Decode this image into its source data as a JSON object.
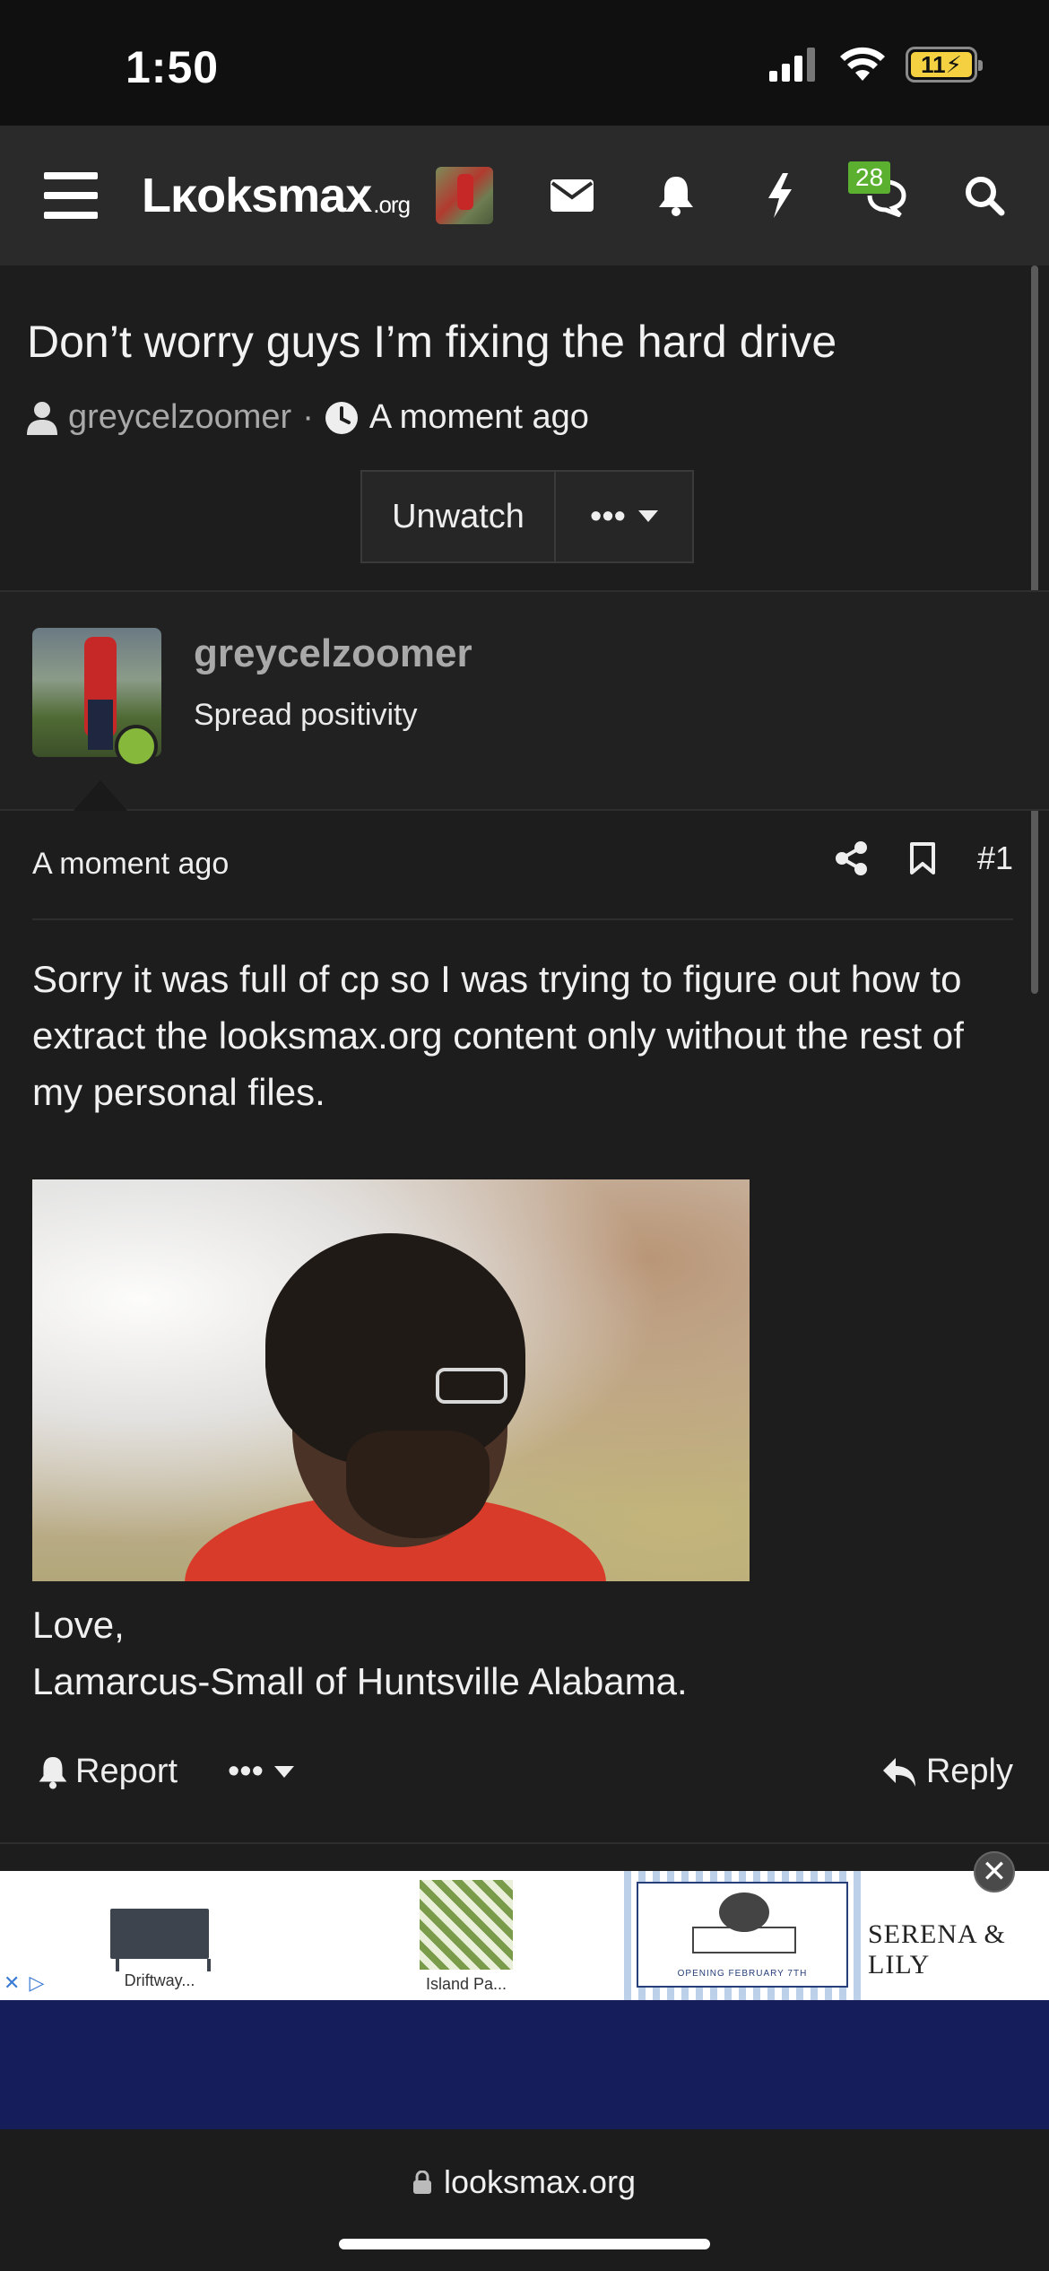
{
  "status_bar": {
    "time": "1:50",
    "battery": "11"
  },
  "nav": {
    "logo": "Lκoksmax",
    "logo_suffix": ".org",
    "chat_badge": "28"
  },
  "thread": {
    "title": "Don’t worry guys I’m fixing the hard drive",
    "author": "greycelzoomer",
    "separator": "·",
    "time": "A moment ago",
    "unwatch_label": "Unwatch",
    "more_label": "•••"
  },
  "post": {
    "username": "greycelzoomer",
    "user_title": "Spread positivity",
    "time": "A moment ago",
    "post_number": "#1",
    "body": "Sorry it was full of cp so I was trying to figure out how to extract the looksmax.org content only without the rest of my personal files.",
    "signature_line1": "Love,",
    "signature_line2": "Lamarcus-Small of Huntsville Alabama.",
    "report_label": "Report",
    "more_label": "•••",
    "reply_label": "Reply"
  },
  "ad": {
    "item1": "Driftway...",
    "item2": "Island Pa...",
    "item3_caption": "OPENING FEBRUARY 7TH",
    "brand": "SERENA & LILY",
    "close": "✕",
    "choices_x": "✕",
    "choices_play": "▷"
  },
  "browser": {
    "url": "looksmax.org"
  }
}
